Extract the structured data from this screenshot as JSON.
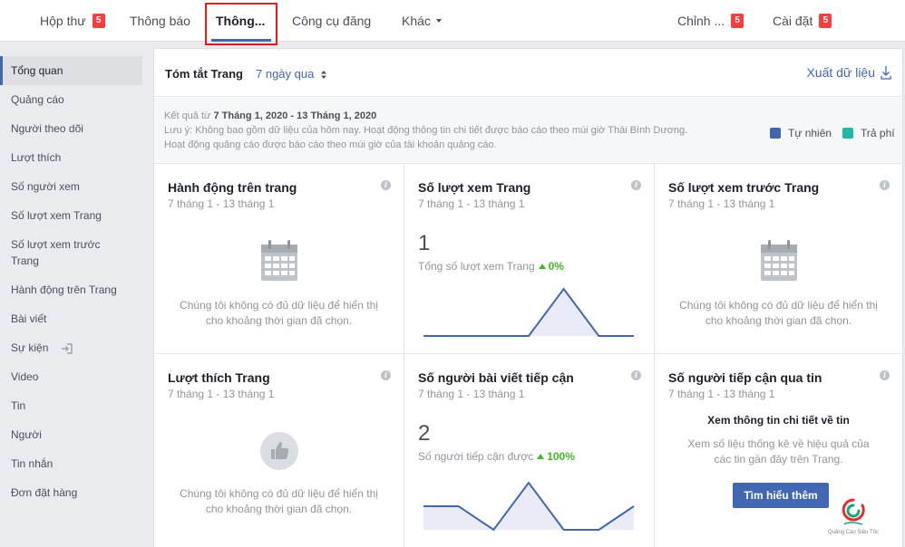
{
  "topnav": {
    "inbox": {
      "label": "Hộp thư",
      "badge": "5"
    },
    "notifications": {
      "label": "Thông báo"
    },
    "insights": {
      "label": "Thông..."
    },
    "publishing_tools": {
      "label": "Công cụ đăng"
    },
    "more": {
      "label": "Khác"
    },
    "edit_page": {
      "label": "Chỉnh ...",
      "badge": "5"
    },
    "settings": {
      "label": "Cài đặt",
      "badge": "5"
    }
  },
  "sidebar": {
    "items": [
      {
        "label": "Tổng quan",
        "active": true
      },
      {
        "label": "Quảng cáo"
      },
      {
        "label": "Người theo dõi"
      },
      {
        "label": "Lượt thích"
      },
      {
        "label": "Số người xem"
      },
      {
        "label": "Số lượt xem Trang"
      },
      {
        "label": "Số lượt xem trước"
      },
      {
        "label": "Trang"
      },
      {
        "label": "Hành động trên Trang"
      },
      {
        "label": "Bài viết"
      },
      {
        "label": "Sự kiện"
      },
      {
        "label": "Video"
      },
      {
        "label": "Tin"
      },
      {
        "label": "Người"
      },
      {
        "label": "Tin nhắn"
      },
      {
        "label": "Đơn đặt hàng"
      }
    ]
  },
  "summary": {
    "title": "Tóm tắt Trang",
    "period": "7 ngày qua",
    "export_label": "Xuất dữ liệu",
    "results_prefix": "Kết quả từ ",
    "results_range": "7 Tháng 1, 2020 - 13 Tháng 1, 2020",
    "note_line1": "Lưu ý: Không bao gồm dữ liệu của hôm nay. Hoạt động thông tin chi tiết được báo cáo theo múi giờ Thái Bình Dương.",
    "note_line2": "Hoạt động quảng cáo được báo cáo theo múi giờ của tài khoản quảng cáo.",
    "legend_organic": "Tự nhiên",
    "legend_paid": "Trả phí",
    "colors": {
      "organic": "#4267b2",
      "paid": "#21b9a1",
      "accent": "#4267b2",
      "positive": "#42b72a",
      "badge": "#fa3e3e"
    }
  },
  "cards": {
    "page_actions": {
      "title": "Hành động trên trang",
      "date": "7 tháng 1 - 13 tháng 1",
      "empty_line1": "Chúng tôi không có đủ dữ liệu để hiển thị",
      "empty_line2": "cho khoảng thời gian đã chọn."
    },
    "page_views": {
      "title": "Số lượt xem Trang",
      "date": "7 tháng 1 - 13 tháng 1",
      "value": "1",
      "metric": "Tổng số lượt xem Trang",
      "delta": "0%",
      "series": [
        0,
        0,
        0,
        0,
        1,
        0,
        0
      ]
    },
    "page_previews": {
      "title": "Số lượt xem trước Trang",
      "date": "7 tháng 1 - 13 tháng 1",
      "empty_line1": "Chúng tôi không có đủ dữ liệu để hiển thị",
      "empty_line2": "cho khoảng thời gian đã chọn."
    },
    "page_likes": {
      "title": "Lượt thích Trang",
      "date": "7 tháng 1 - 13 tháng 1",
      "empty_line1": "Chúng tôi không có đủ dữ liệu để hiển thị",
      "empty_line2": "cho khoảng thời gian đã chọn."
    },
    "post_reach": {
      "title": "Số người bài viết tiếp cận",
      "date": "7 tháng 1 - 13 tháng 1",
      "value": "2",
      "metric": "Số người tiếp cận được",
      "delta": "100%",
      "series": [
        1,
        1,
        0,
        2,
        0,
        0,
        1
      ]
    },
    "story_reach": {
      "title": "Số người tiếp cận qua tin",
      "date": "7 tháng 1 - 13 tháng 1",
      "promo_title": "Xem thông tin chi tiết về tin",
      "promo_line1": "Xem số liệu thống kê về hiệu quả của",
      "promo_line2": "các tin gần đây trên Trang.",
      "button": "Tìm hiểu thêm"
    }
  },
  "watermark": {
    "text": "Quảng Cáo Siêu Tốc"
  }
}
